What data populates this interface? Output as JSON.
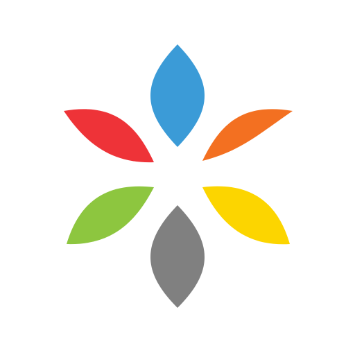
{
  "logo": {
    "name": "six-petal-flower-logo",
    "background": "#ffffff",
    "petals": [
      {
        "name": "top",
        "color": "#3B9BD7"
      },
      {
        "name": "upper-right",
        "color": "#F37021"
      },
      {
        "name": "lower-right",
        "color": "#FCD500"
      },
      {
        "name": "bottom",
        "color": "#808080"
      },
      {
        "name": "lower-left",
        "color": "#8DC63F"
      },
      {
        "name": "upper-left",
        "color": "#EE3338"
      }
    ]
  }
}
